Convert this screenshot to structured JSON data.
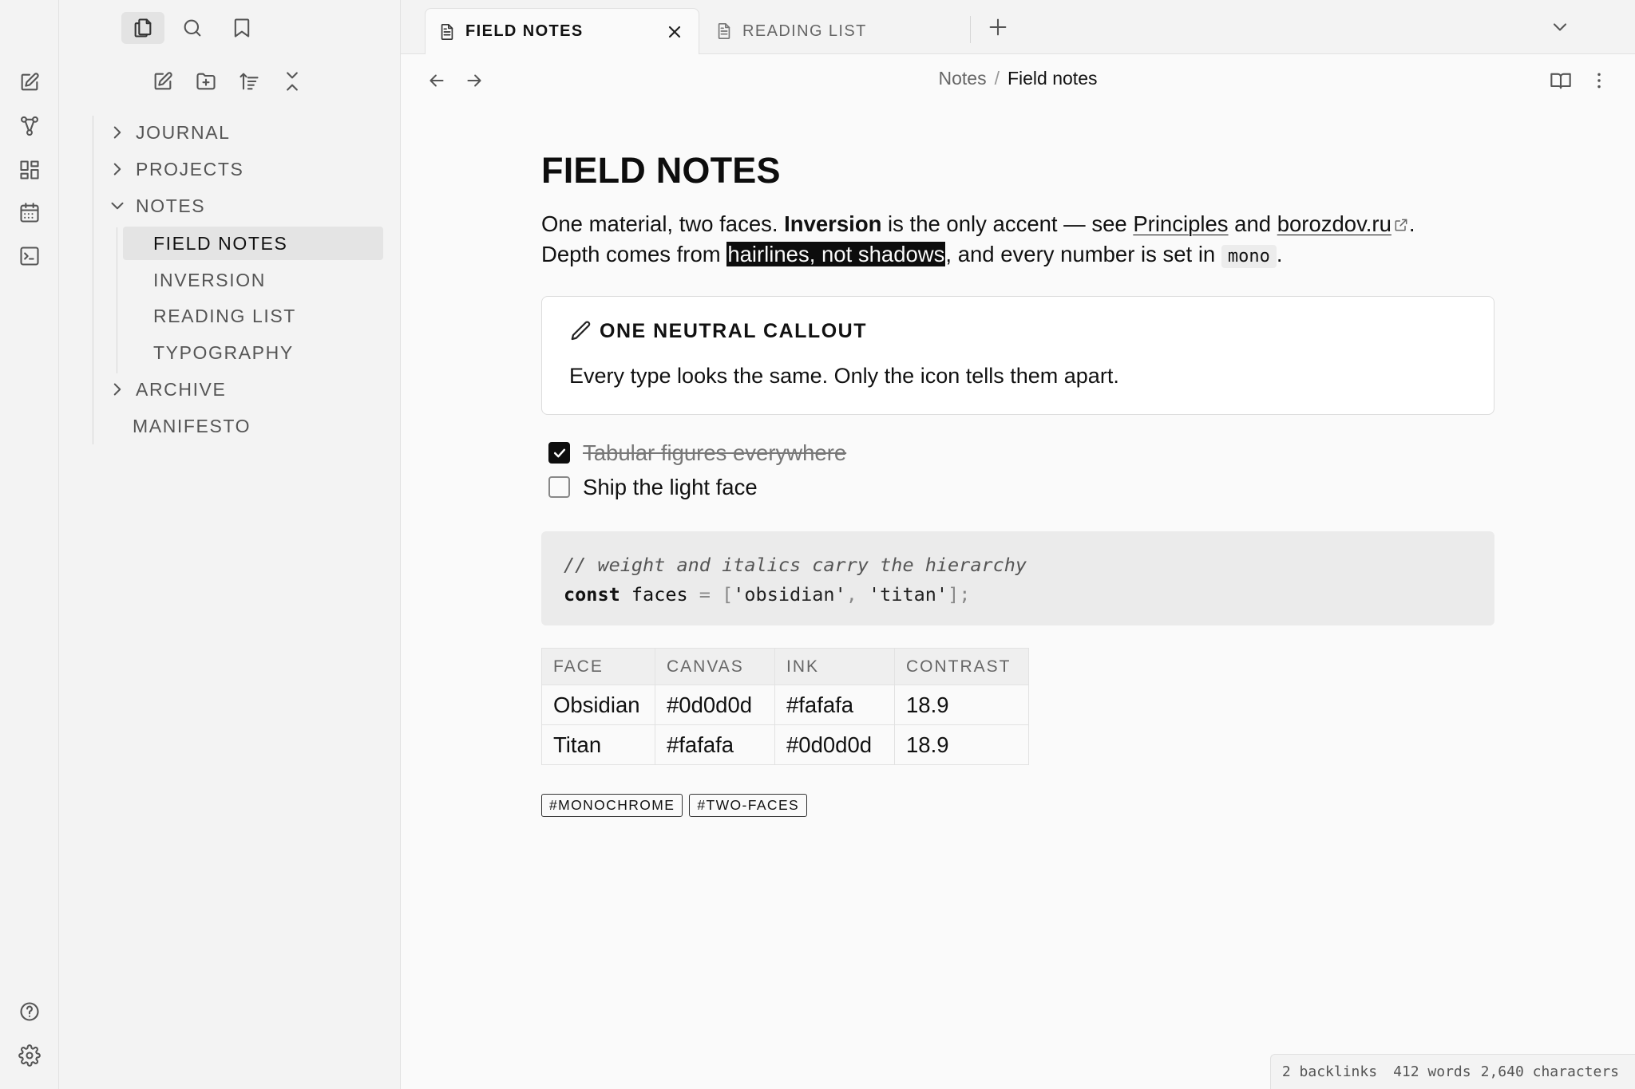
{
  "tabs": [
    {
      "label": "FIELD NOTES",
      "active": true
    },
    {
      "label": "READING LIST",
      "active": false
    }
  ],
  "sidebar": {
    "tree": [
      {
        "type": "folder",
        "label": "JOURNAL",
        "expanded": false
      },
      {
        "type": "folder",
        "label": "PROJECTS",
        "expanded": false
      },
      {
        "type": "folder",
        "label": "NOTES",
        "expanded": true,
        "children": [
          {
            "label": "FIELD NOTES",
            "active": true
          },
          {
            "label": "INVERSION"
          },
          {
            "label": "READING LIST"
          },
          {
            "label": "TYPOGRAPHY"
          }
        ]
      },
      {
        "type": "folder",
        "label": "ARCHIVE",
        "expanded": false
      },
      {
        "type": "file",
        "label": "MANIFESTO"
      }
    ]
  },
  "breadcrumb": {
    "parent": "Notes",
    "separator": "/",
    "current": "Field notes"
  },
  "doc": {
    "title": "FIELD NOTES",
    "p1": {
      "t1": "One material, two faces. ",
      "bold": "Inversion",
      "t2": " is the only accent — see ",
      "link1": "Principles",
      "t3": " and ",
      "link2": "borozdov.ru",
      "t4": ".",
      "t5": "Depth comes from ",
      "highlight": "hairlines, not shadows",
      "t6": ", and every number is set in ",
      "code": "mono",
      "t7": "."
    },
    "callout": {
      "title": "ONE NEUTRAL CALLOUT",
      "body": "Every type looks the same. Only the icon tells them apart."
    },
    "tasks": [
      {
        "label": "Tabular figures everywhere",
        "done": true
      },
      {
        "label": "Ship the light face",
        "done": false
      }
    ],
    "code": {
      "comment": "// weight and italics carry the hierarchy",
      "kw": "const",
      "ident": " faces ",
      "eq": "= [",
      "s1": "'obsidian'",
      "comma": ", ",
      "s2": "'titan'",
      "end": "];"
    },
    "table": {
      "headers": [
        "FACE",
        "CANVAS",
        "INK",
        "CONTRAST"
      ],
      "rows": [
        [
          "Obsidian",
          "#0d0d0d",
          "#fafafa",
          "18.9"
        ],
        [
          "Titan",
          "#fafafa",
          "#0d0d0d",
          "18.9"
        ]
      ]
    },
    "tags": [
      "#MONOCHROME",
      "#TWO-FACES"
    ]
  },
  "status": {
    "backlinks": "2 backlinks",
    "words": "412 words",
    "chars": "2,640 characters"
  },
  "colors": {
    "canvas": "#fafafa",
    "ink": "#0d0d0d",
    "chrome": "#f3f3f3"
  }
}
